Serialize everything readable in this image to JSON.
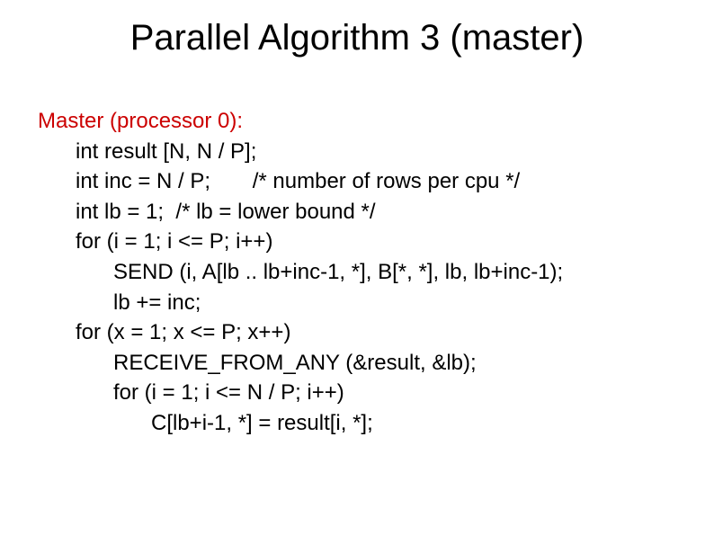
{
  "title": "Parallel Algorithm 3 (master)",
  "code": {
    "l0": "Master (processor 0):",
    "l1": "int result [N, N / P];",
    "l2": "int inc = N / P;       /* number of rows per cpu */",
    "l3": "int lb = 1;  /* lb = lower bound */",
    "l4": "for (i = 1; i <= P; i++)",
    "l5": "SEND (i, A[lb .. lb+inc-1, *], B[*, *], lb, lb+inc-1);",
    "l6": "lb += inc;",
    "l7": "for (x = 1; x <= P; x++)",
    "l8": "RECEIVE_FROM_ANY (&result, &lb);",
    "l9": "for (i = 1; i <= N / P; i++)",
    "l10": "C[lb+i-1, *] = result[i, *];"
  }
}
